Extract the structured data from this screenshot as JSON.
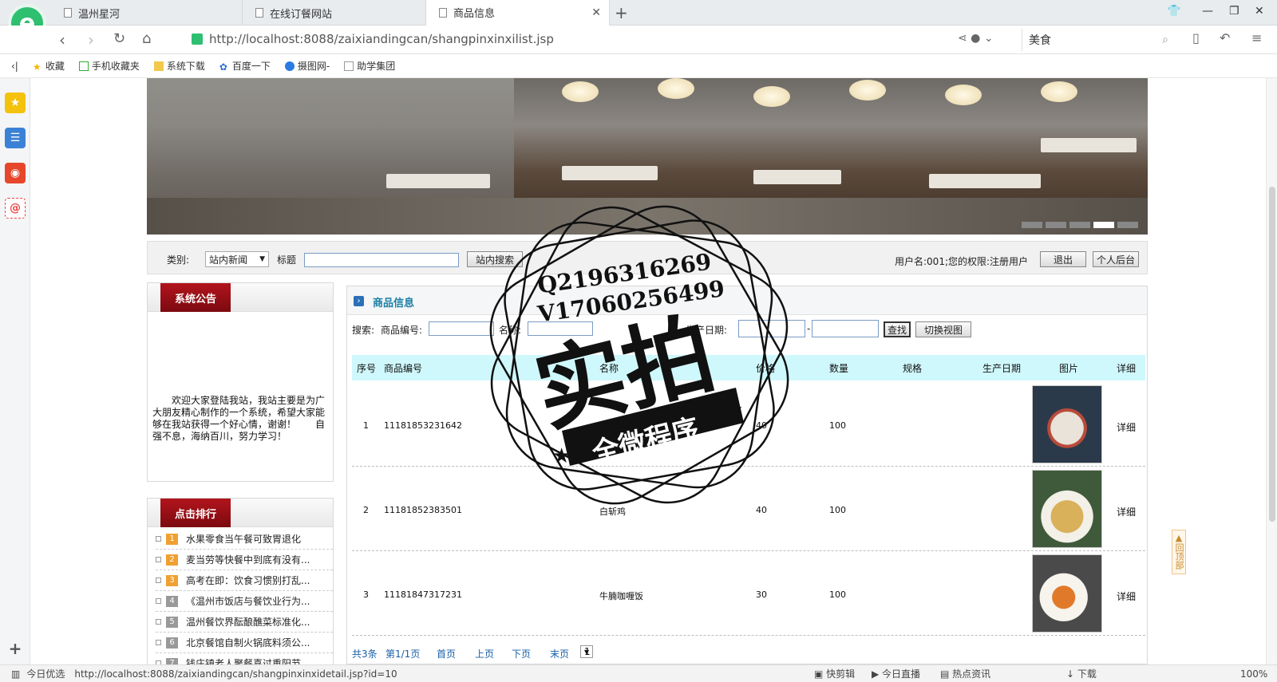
{
  "browser": {
    "tabs": [
      {
        "title": "温州星河"
      },
      {
        "title": "在线订餐网站"
      },
      {
        "title": "商品信息"
      }
    ],
    "url": "http://localhost:8088/zaixiandingcan/shangpinxinxilist.jsp",
    "search_value": "美食",
    "bookmarks": [
      "收藏",
      "手机收藏夹",
      "系统下载",
      "百度一下",
      "摄图网-",
      "助学集团"
    ],
    "status_url": "http://localhost:8088/zaixiandingcan/shangpinxinxidetail.jsp?id=10",
    "status_left": "今日优选",
    "status_items": [
      "快剪辑",
      "今日直播",
      "热点资讯",
      "下载",
      "100%"
    ]
  },
  "searchbar": {
    "category_label": "类别:",
    "category_value": "站内新闻",
    "title_label": "标题",
    "search_button": "站内搜索",
    "user_info": "用户名:001;您的权限:注册用户",
    "logout_button": "退出",
    "backend_button": "个人后台"
  },
  "notice": {
    "title": "系统公告",
    "text": "欢迎大家登陆我站，我站主要是为广大朋友精心制作的一个系统，希望大家能够在我站获得一个好心情，谢谢！　　自强不息，海纳百川，努力学习！"
  },
  "ranking": {
    "title": "点击排行",
    "items": [
      {
        "num": "1",
        "text": "水果零食当午餐可致胃退化"
      },
      {
        "num": "2",
        "text": "麦当劳等快餐中到底有没有..."
      },
      {
        "num": "3",
        "text": "高考在即：饮食习惯别打乱..."
      },
      {
        "num": "4",
        "text": "《温州市饭店与餐饮业行为..."
      },
      {
        "num": "5",
        "text": "温州餐饮界酝酿醮菜标准化..."
      },
      {
        "num": "6",
        "text": "北京餐馆自制火锅底料须公..."
      },
      {
        "num": "7",
        "text": "钱庄镇老人聚餐喜过重阳节"
      }
    ]
  },
  "main": {
    "title": "商品信息",
    "search_label": "搜索:",
    "code_label": "商品编号:",
    "name_label": "名称:",
    "date_label": "生产日期:",
    "date_sep": "-",
    "find_button": "查找",
    "toggle_button": "切换视图",
    "columns": [
      "序号",
      "商品编号",
      "名称",
      "价格",
      "数量",
      "规格",
      "生产日期",
      "图片",
      "详细"
    ],
    "rows": [
      {
        "idx": "1",
        "code": "11181853231642",
        "name": "香辣…",
        "price": "40",
        "qty": "100",
        "spec": "",
        "date": "",
        "detail": "详细"
      },
      {
        "idx": "2",
        "code": "11181852383501",
        "name": "白斩鸡",
        "price": "40",
        "qty": "100",
        "spec": "",
        "date": "",
        "detail": "详细"
      },
      {
        "idx": "3",
        "code": "11181847317231",
        "name": "牛腩咖喱饭",
        "price": "30",
        "qty": "100",
        "spec": "",
        "date": "",
        "detail": "详细"
      }
    ],
    "pager": {
      "total": "共3条",
      "page": "第1/1页",
      "first": "首页",
      "prev": "上页",
      "next": "下页",
      "last": "末页",
      "select": "1"
    }
  },
  "watermark": {
    "line1": "Q2196316269",
    "line2": "V17060256499",
    "big": "实拍",
    "ribbon": "全微程序"
  },
  "backtop": "回顶部"
}
